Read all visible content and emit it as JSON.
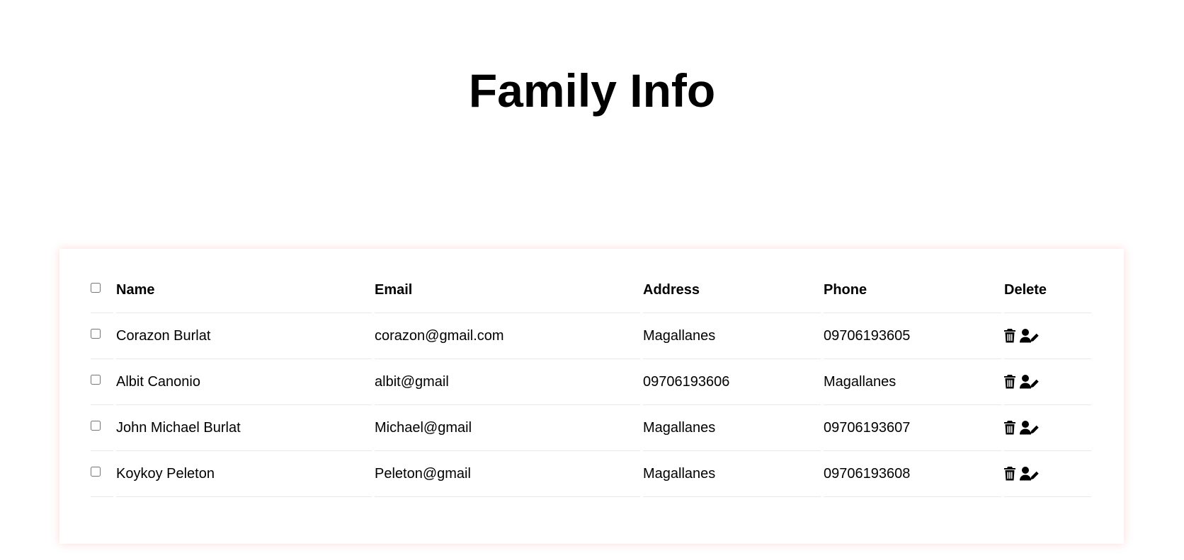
{
  "page": {
    "title": "Family Info"
  },
  "table": {
    "headers": {
      "name": "Name",
      "email": "Email",
      "address": "Address",
      "phone": "Phone",
      "delete": "Delete"
    },
    "rows": [
      {
        "name": "Corazon Burlat",
        "email": "corazon@gmail.com",
        "address": "Magallanes",
        "phone": "09706193605"
      },
      {
        "name": "Albit Canonio",
        "email": "albit@gmail",
        "address": "09706193606",
        "phone": "Magallanes"
      },
      {
        "name": "John Michael Burlat",
        "email": "Michael@gmail",
        "address": "Magallanes",
        "phone": "09706193607"
      },
      {
        "name": "Koykoy Peleton",
        "email": "Peleton@gmail",
        "address": "Magallanes",
        "phone": "09706193608"
      }
    ],
    "row_actions": [
      "trash-icon",
      "user-edit-icon"
    ]
  },
  "colors": {
    "card_shadow": "#ff7878",
    "row_border": "#e8e8e8",
    "text": "#000000"
  }
}
